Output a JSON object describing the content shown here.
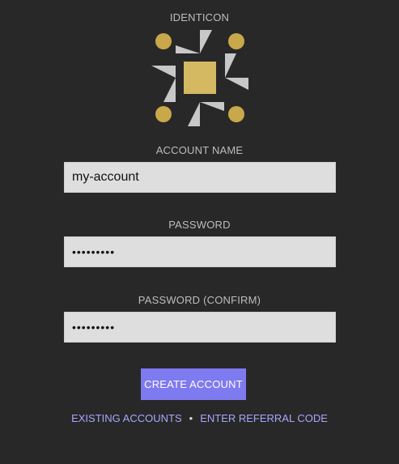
{
  "identicon": {
    "label": "IDENTICON",
    "accent_color": "#c8a84a",
    "square_color": "#d4b862",
    "triangle_color": "#c8c8c8"
  },
  "account_name": {
    "label": "ACCOUNT NAME",
    "value": "my-account"
  },
  "password": {
    "label": "PASSWORD",
    "value": "•••••••••"
  },
  "password_confirm": {
    "label": "PASSWORD (CONFIRM)",
    "value": "•••••••••"
  },
  "actions": {
    "create_label": "CREATE ACCOUNT",
    "create_color": "#7e7af0",
    "existing_label": "EXISTING ACCOUNTS",
    "separator": "•",
    "referral_label": "ENTER REFERRAL CODE",
    "link_color": "#a9a5ff"
  }
}
